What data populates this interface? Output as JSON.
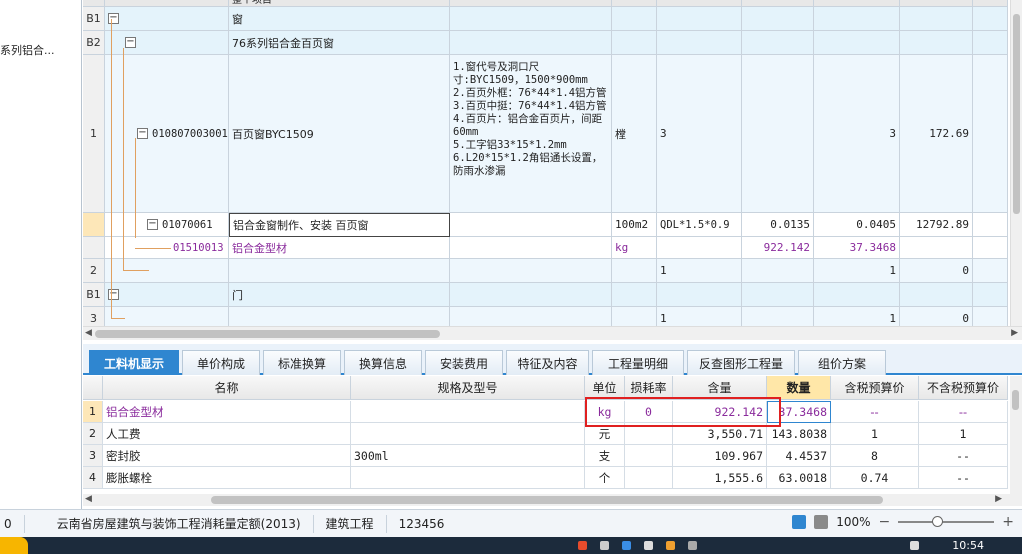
{
  "left_panel": {
    "tree_label": "系列铝合..."
  },
  "top_grid": {
    "header_partial": "整个项目",
    "rows": [
      {
        "num": "B1",
        "code": "",
        "name": "窗",
        "feature": "",
        "unit": "",
        "expr": "",
        "content": "",
        "qty": "",
        "price": ""
      },
      {
        "num": "B2",
        "code": "",
        "name": "76系列铝合金百页窗",
        "feature": "",
        "unit": "",
        "expr": "",
        "content": "",
        "qty": "",
        "price": ""
      },
      {
        "num": "1",
        "code": "010807003001",
        "name": "百页窗BYC1509",
        "feature": "1.窗代号及洞口尺寸:BYC1509，1500*900mm\n2.百页外框：76*44*1.4铝方管\n3.百页中挺：76*44*1.4铝方管\n4.百页片：铝合金百页片，间距60mm\n5.工字铝33*15*1.2mm\n6.L20*15*1.2角铝通长设置，防雨水渗漏",
        "unit": "樘",
        "expr": "3",
        "content": "",
        "qty": "3",
        "price": "172.69"
      },
      {
        "num": "",
        "code": "01070061",
        "name": "铝合金窗制作、安装 百页窗",
        "feature": "",
        "unit": "100m2",
        "expr": "QDL*1.5*0.9",
        "content": "0.0135",
        "qty": "0.0405",
        "price": "12792.89"
      },
      {
        "num": "",
        "code": "01510013",
        "name": "铝合金型材",
        "feature": "",
        "unit": "kg",
        "expr": "",
        "content": "922.142",
        "qty": "37.3468",
        "price": ""
      },
      {
        "num": "2",
        "code": "",
        "name": "",
        "feature": "",
        "unit": "",
        "expr": "1",
        "content": "",
        "qty": "1",
        "price": "0"
      },
      {
        "num": "B1",
        "code": "",
        "name": "门",
        "feature": "",
        "unit": "",
        "expr": "",
        "content": "",
        "qty": "",
        "price": ""
      },
      {
        "num": "3",
        "code": "",
        "name": "",
        "feature": "",
        "unit": "",
        "expr": "1",
        "content": "",
        "qty": "1",
        "price": "0"
      }
    ]
  },
  "tabs": [
    {
      "label": "工料机显示",
      "active": true
    },
    {
      "label": "单价构成"
    },
    {
      "label": "标准换算"
    },
    {
      "label": "换算信息"
    },
    {
      "label": "安装费用"
    },
    {
      "label": "特征及内容"
    },
    {
      "label": "工程量明细"
    },
    {
      "label": "反查图形工程量"
    },
    {
      "label": "组价方案"
    }
  ],
  "bottom_grid": {
    "headers": [
      "名称",
      "规格及型号",
      "单位",
      "损耗率",
      "含量",
      "数量",
      "含税预算价",
      "不含税预算价"
    ],
    "rows": [
      {
        "num": "1",
        "name": "铝合金型材",
        "spec": "",
        "unit": "kg",
        "loss": "0",
        "content": "922.142",
        "qty": "37.3468",
        "tax_price": "--",
        "notax_price": "--"
      },
      {
        "num": "2",
        "name": "人工费",
        "spec": "",
        "unit": "元",
        "loss": "",
        "content": "3,550.71",
        "qty": "143.8038",
        "tax_price": "1",
        "notax_price": "1"
      },
      {
        "num": "3",
        "name": "密封胶",
        "spec": "300ml",
        "unit": "支",
        "loss": "",
        "content": "109.967",
        "qty": "4.4537",
        "tax_price": "8",
        "notax_price": "--"
      },
      {
        "num": "4",
        "name": "膨胀螺栓",
        "spec": "",
        "unit": "个",
        "loss": "",
        "content": "1,555.6",
        "qty": "63.0018",
        "tax_price": "0.74",
        "notax_price": "--"
      }
    ]
  },
  "status_bar": {
    "seg0": "0",
    "quota": "云南省房屋建筑与装饰工程消耗量定额(2013)",
    "type": "建筑工程",
    "code": "123456",
    "zoom": "100%"
  },
  "taskbar": {
    "clock": "10:54"
  }
}
